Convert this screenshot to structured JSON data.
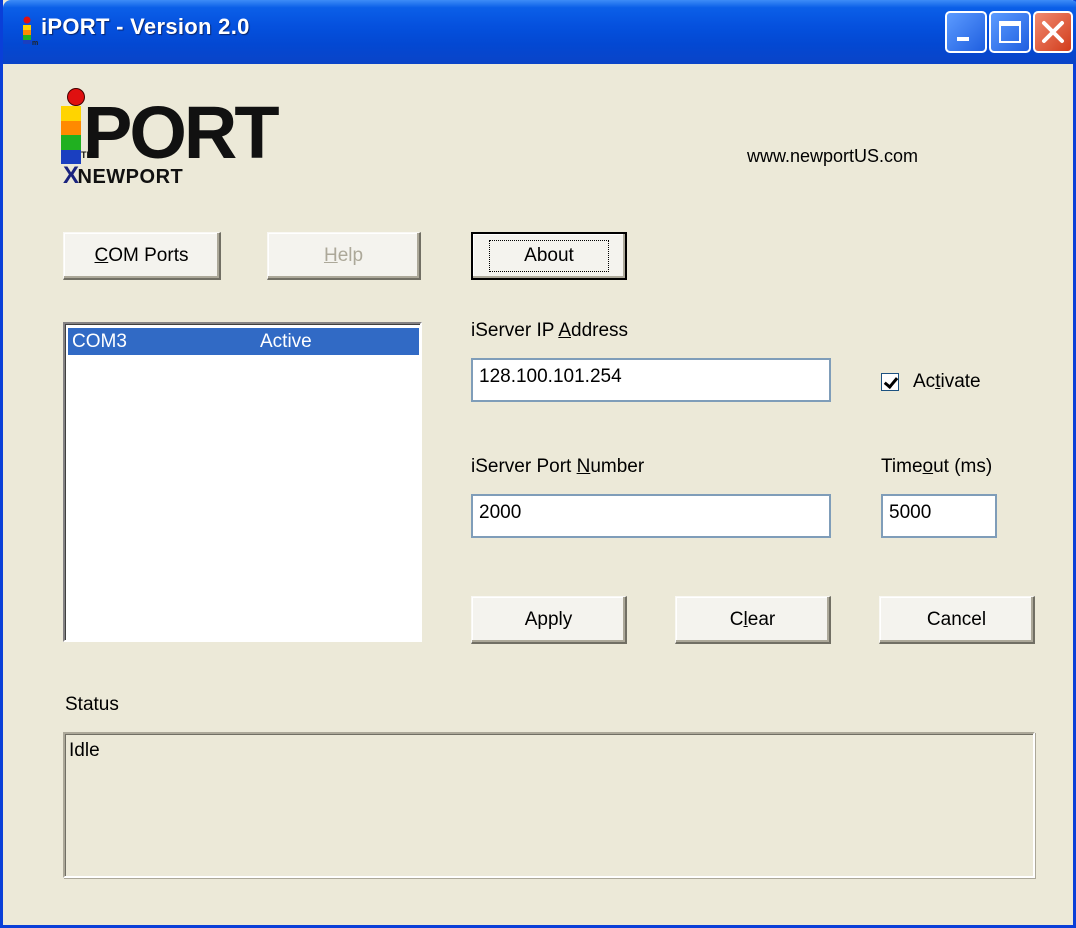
{
  "window": {
    "title": "iPORT - Version 2.0",
    "colors": {
      "titlebar": "#0551de",
      "face": "#ece9d8",
      "selection": "#316ac5"
    }
  },
  "logo": {
    "brand": "PORT",
    "sub": "NEWPORT",
    "tm": "TM"
  },
  "website": "www.newportUS.com",
  "buttons": {
    "com_ports": {
      "pre": "",
      "mn": "C",
      "post": "OM Ports"
    },
    "help": {
      "pre": "",
      "mn": "H",
      "post": "elp"
    },
    "about": "About",
    "apply": "Apply",
    "clear": {
      "pre": "C",
      "mn": "l",
      "post": "ear"
    },
    "cancel": "Cancel"
  },
  "com_list": {
    "items": [
      {
        "port": "COM3",
        "state": "Active",
        "selected": true
      }
    ]
  },
  "ip": {
    "label": {
      "pre": "iServer IP ",
      "mn": "A",
      "post": "ddress"
    },
    "value": "128.100.101.254"
  },
  "activate": {
    "label": {
      "pre": "Ac",
      "mn": "t",
      "post": "ivate"
    },
    "checked": true
  },
  "port_number": {
    "label": {
      "pre": "iServer Port ",
      "mn": "N",
      "post": "umber"
    },
    "value": "2000"
  },
  "timeout": {
    "label": {
      "pre": "Time",
      "mn": "o",
      "post": "ut (ms)"
    },
    "value": "5000"
  },
  "status": {
    "label": "Status",
    "value": "Idle"
  }
}
